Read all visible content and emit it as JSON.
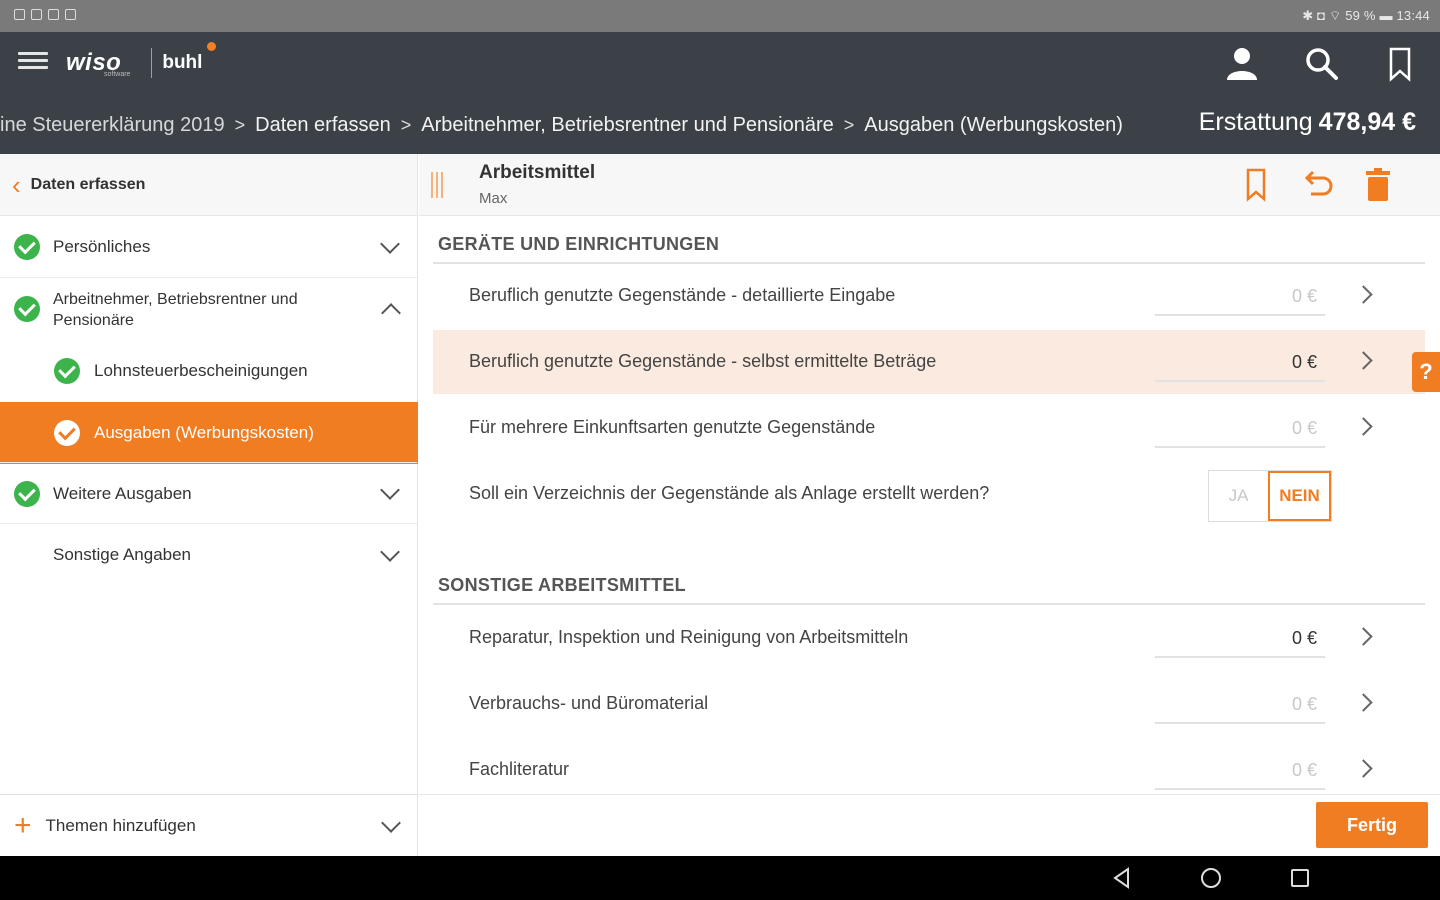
{
  "status_bar": {
    "right_text": "✱ ◘ ⌔ 59 % ▬ 13:44"
  },
  "header": {
    "logo_brand": "wiso",
    "logo_sub": "software",
    "logo_product": "buhl",
    "breadcrumb": [
      "ine Steuererklärung 2019",
      "Daten erfassen",
      "Arbeitnehmer, Betriebsrentner und Pensionäre",
      "Ausgaben (Werbungskosten)"
    ],
    "refund_label": "Erstattung",
    "refund_value": "478,94 €"
  },
  "sidebar": {
    "back_label": "Daten erfassen",
    "items": [
      {
        "label": "Persönliches"
      },
      {
        "label": "Arbeitnehmer, Betriebsrentner und Pensionäre"
      },
      {
        "label": "Lohnsteuerbescheinigungen"
      },
      {
        "label": "Ausgaben (Werbungskosten)"
      },
      {
        "label": "Weitere Ausgaben"
      },
      {
        "label": "Sonstige Angaben"
      }
    ],
    "footer_label": "Themen hinzufügen"
  },
  "main": {
    "title": "Arbeitsmittel",
    "subtitle": "Max",
    "sections": [
      {
        "title": "GERÄTE UND EINRICHTUNGEN",
        "rows": [
          {
            "label": "Beruflich genutzte Gegenstände - detaillierte Eingabe",
            "value": "0 €"
          },
          {
            "label": "Beruflich genutzte Gegenstände - selbst ermittelte Beträge",
            "value": "0 €"
          },
          {
            "label": "Für mehrere Einkunftsarten genutzte Gegenstände",
            "value": "0 €"
          },
          {
            "label": "Soll ein Verzeichnis der Gegenstände als Anlage erstellt werden?",
            "option_yes": "JA",
            "option_no": "NEIN"
          }
        ]
      },
      {
        "title": "SONSTIGE ARBEITSMITTEL",
        "rows": [
          {
            "label": "Reparatur, Inspektion und Reinigung von Arbeitsmitteln",
            "value": "0 €"
          },
          {
            "label": "Verbrauchs- und Büromaterial",
            "value": "0 €"
          },
          {
            "label": "Fachliteratur",
            "value": "0 €"
          }
        ]
      }
    ],
    "help_label": "?",
    "done_label": "Fertig"
  },
  "colors": {
    "accent": "#f07d22",
    "header_bg": "#3c4147",
    "check_green": "#3cb44b",
    "highlight_row": "#fbeadf"
  }
}
